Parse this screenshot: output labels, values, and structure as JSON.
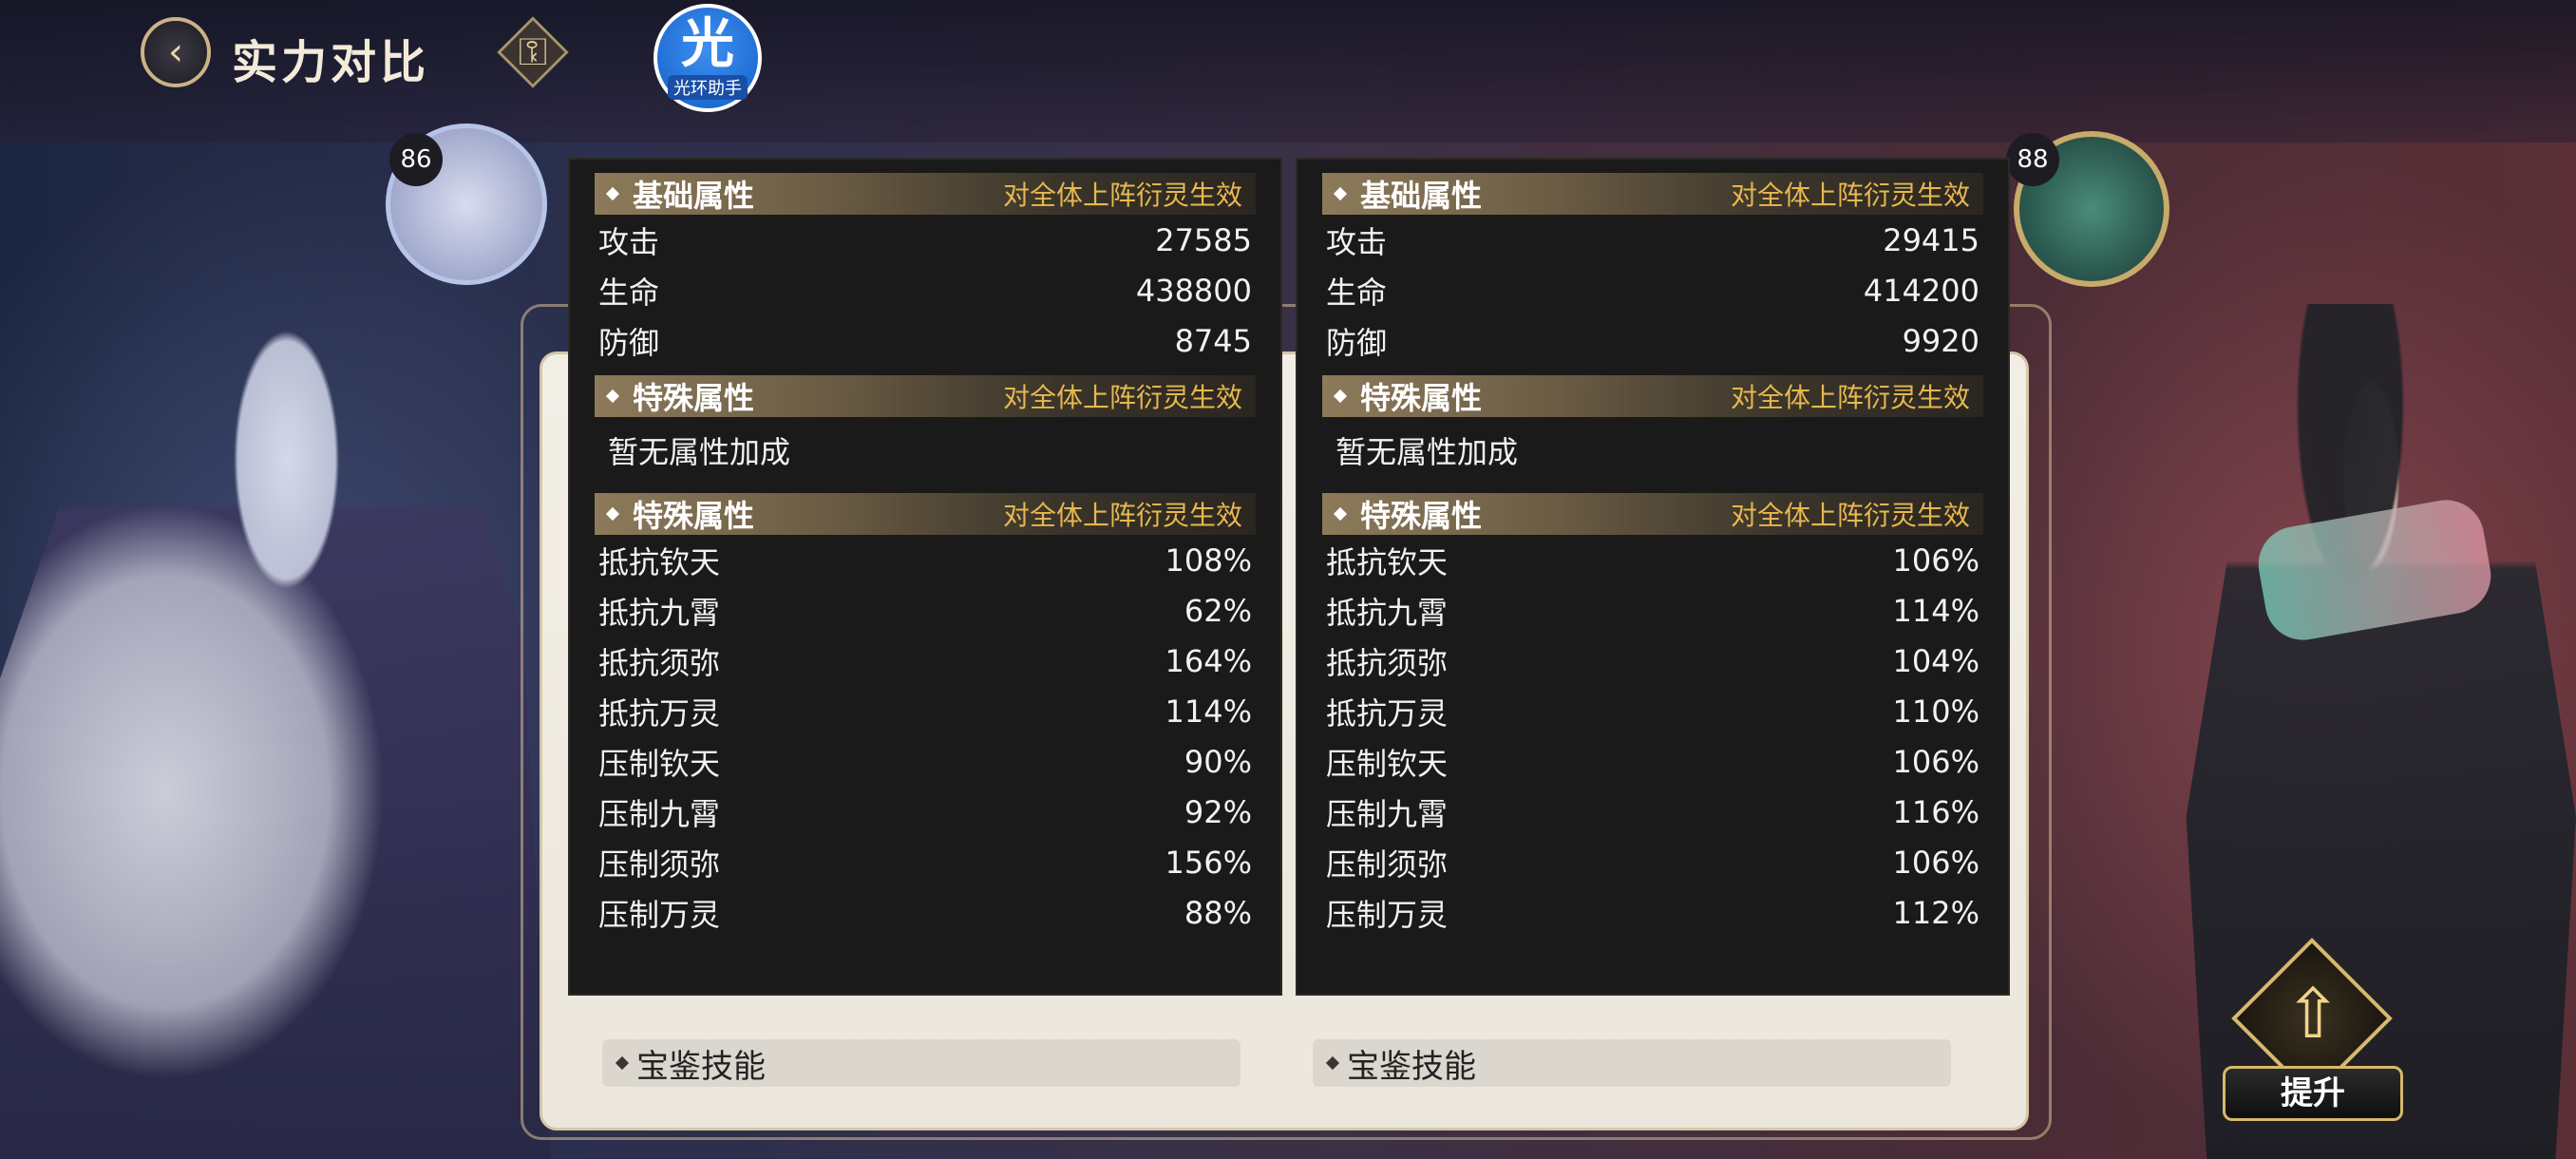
{
  "header": {
    "title": "实力对比",
    "back_icon": "back-arrow-icon",
    "lock_icon": "keyhole-icon",
    "helper": {
      "char": "光",
      "label": "光环助手"
    }
  },
  "left": {
    "level": "86",
    "basic": {
      "title": "基础属性",
      "note": "对全体上阵衍灵生效",
      "rows": [
        {
          "label": "攻击",
          "value": "27585"
        },
        {
          "label": "生命",
          "value": "438800"
        },
        {
          "label": "防御",
          "value": "8745"
        }
      ]
    },
    "special1": {
      "title": "特殊属性",
      "note": "对全体上阵衍灵生效",
      "none_text": "暂无属性加成"
    },
    "special2": {
      "title": "特殊属性",
      "note": "对全体上阵衍灵生效",
      "rows": [
        {
          "label": "抵抗钦天",
          "value": "108%"
        },
        {
          "label": "抵抗九霄",
          "value": "62%"
        },
        {
          "label": "抵抗须弥",
          "value": "164%"
        },
        {
          "label": "抵抗万灵",
          "value": "114%"
        },
        {
          "label": "压制钦天",
          "value": "90%"
        },
        {
          "label": "压制九霄",
          "value": "92%"
        },
        {
          "label": "压制须弥",
          "value": "156%"
        },
        {
          "label": "压制万灵",
          "value": "88%"
        }
      ]
    },
    "skill": "宝鉴技能"
  },
  "right": {
    "level": "88",
    "basic": {
      "title": "基础属性",
      "note": "对全体上阵衍灵生效",
      "rows": [
        {
          "label": "攻击",
          "value": "29415"
        },
        {
          "label": "生命",
          "value": "414200"
        },
        {
          "label": "防御",
          "value": "9920"
        }
      ]
    },
    "special1": {
      "title": "特殊属性",
      "note": "对全体上阵衍灵生效",
      "none_text": "暂无属性加成"
    },
    "special2": {
      "title": "特殊属性",
      "note": "对全体上阵衍灵生效",
      "rows": [
        {
          "label": "抵抗钦天",
          "value": "106%"
        },
        {
          "label": "抵抗九霄",
          "value": "114%"
        },
        {
          "label": "抵抗须弥",
          "value": "104%"
        },
        {
          "label": "抵抗万灵",
          "value": "110%"
        },
        {
          "label": "压制钦天",
          "value": "106%"
        },
        {
          "label": "压制九霄",
          "value": "116%"
        },
        {
          "label": "压制须弥",
          "value": "106%"
        },
        {
          "label": "压制万灵",
          "value": "112%"
        }
      ]
    },
    "skill": "宝鉴技能"
  },
  "upgrade": {
    "label": "提升",
    "icon": "double-up-arrow-icon"
  },
  "colors": {
    "accent_gold": "#e7b84e",
    "panel_bg": "#1a1a1a"
  }
}
